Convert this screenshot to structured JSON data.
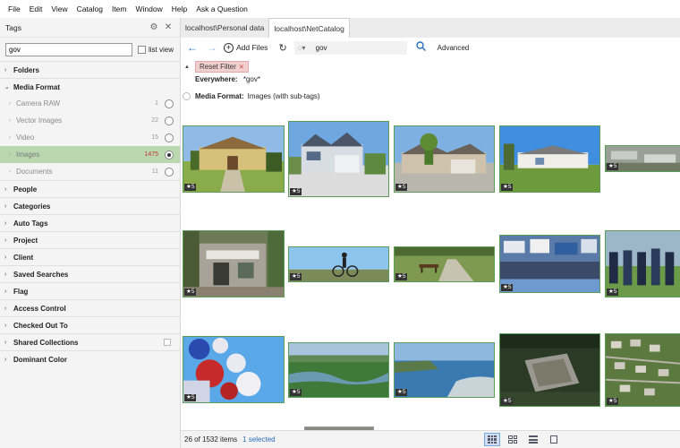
{
  "menu": [
    "File",
    "Edit",
    "View",
    "Catalog",
    "Item",
    "Window",
    "Help",
    "Ask a Question"
  ],
  "sidebar": {
    "title": "Tags",
    "search_value": "gov",
    "list_view_label": "list view",
    "sections_top": [
      {
        "label": "Folders"
      }
    ],
    "media_format": {
      "label": "Media Format",
      "items": [
        {
          "label": "Camera RAW",
          "count": "1"
        },
        {
          "label": "Vector Images",
          "count": "22"
        },
        {
          "label": "Video",
          "count": "15"
        },
        {
          "label": "Images",
          "count": "1475"
        },
        {
          "label": "Documents",
          "count": "11"
        }
      ]
    },
    "sections": [
      {
        "label": "People"
      },
      {
        "label": "Categories"
      },
      {
        "label": "Auto Tags"
      },
      {
        "label": "Project"
      },
      {
        "label": "Client"
      },
      {
        "label": "Saved Searches"
      },
      {
        "label": "Flag"
      },
      {
        "label": "Access Control"
      },
      {
        "label": "Checked Out To"
      },
      {
        "label": "Shared Collections"
      },
      {
        "label": "Dominant Color"
      }
    ]
  },
  "tabs": [
    {
      "label": "localhost\\Personal data"
    },
    {
      "label": "localhost\\NetCatalog"
    }
  ],
  "toolbar": {
    "add_files": "Add Files",
    "query": "gov",
    "advanced": "Advanced"
  },
  "filter": {
    "reset_label": "Reset Filter",
    "everywhere_label": "Everywhere:",
    "everywhere_value": "*gov*",
    "media_format_label": "Media Format:",
    "media_format_value": "Images (with sub-tags)"
  },
  "thumbnails": [
    {
      "scene": "house-yellow",
      "rating": "5"
    },
    {
      "scene": "house-blue",
      "rating": "5"
    },
    {
      "scene": "house-stone",
      "rating": "5"
    },
    {
      "scene": "house-white",
      "rating": "5"
    },
    {
      "scene": "aerial-lot",
      "rating": "5"
    },
    {
      "scene": "shop-front",
      "rating": "5"
    },
    {
      "scene": "cyclist",
      "rating": "5"
    },
    {
      "scene": "park-bench",
      "rating": "5"
    },
    {
      "scene": "protest-crowd",
      "rating": "5"
    },
    {
      "scene": "police-line",
      "rating": "5"
    },
    {
      "scene": "balloons",
      "rating": "5"
    },
    {
      "scene": "aerial-forest",
      "rating": "5"
    },
    {
      "scene": "aerial-lake",
      "rating": "5"
    },
    {
      "scene": "aerial-fort",
      "rating": "5"
    },
    {
      "scene": "aerial-suburb",
      "rating": "5"
    }
  ],
  "status": {
    "count": "26 of 1532 items",
    "selected": "1 selected"
  }
}
